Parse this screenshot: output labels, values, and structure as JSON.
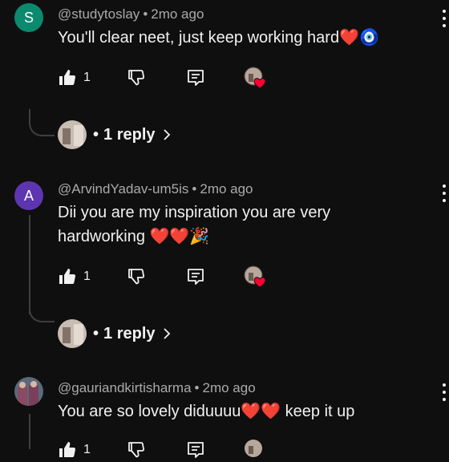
{
  "comments": [
    {
      "avatar_letter": "S",
      "avatar_color": "#0b8a6f",
      "author": "@studytoslay",
      "time": "2mo ago",
      "text": "You'll clear neet, just keep working hard❤️🧿",
      "likes": "1",
      "replies": "1 reply"
    },
    {
      "avatar_letter": "A",
      "avatar_color": "#5e35b1",
      "author": "@ArvindYadav-um5is",
      "time": "2mo ago",
      "text_line1": "Dii you are my inspiration you are very",
      "text_line2": "hardworking ❤️❤️🎉",
      "likes": "1",
      "replies": "1 reply"
    },
    {
      "author": "@gauriandkirtisharma",
      "time": "2mo ago",
      "text": "You are so lovely diduuuu❤️❤️ keep it up",
      "likes": "1"
    }
  ],
  "separator": "•"
}
